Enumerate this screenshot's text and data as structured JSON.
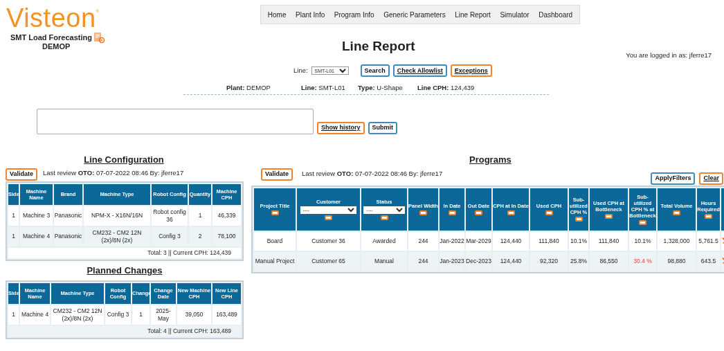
{
  "logo": {
    "name": "Visteon",
    "mark": "®",
    "app_name": "SMT Load Forecasting",
    "plant": "DEMOP"
  },
  "nav": [
    "Home",
    "Plant Info",
    "Program Info",
    "Generic Parameters",
    "Line Report",
    "Simulator",
    "Dashboard"
  ],
  "page_title": "Line Report",
  "user": {
    "label": "You are logged in as:",
    "name": "jferre17"
  },
  "line_picker": {
    "label": "Line:",
    "value": "SMT-L01"
  },
  "top_buttons": [
    {
      "label": "Search",
      "kind": "submit"
    },
    {
      "label": "Check Allowlist",
      "kind": "link"
    },
    {
      "label": "Exceptions",
      "kind": "reset"
    }
  ],
  "info": [
    {
      "label": "Plant:",
      "value": "DEMOP"
    },
    {
      "label": "Line:",
      "value": "SMT-L01"
    },
    {
      "label": "Type:",
      "value": "U-Shape"
    },
    {
      "label": "Line CPH:",
      "value": "124,439"
    }
  ],
  "comment_buttons": [
    {
      "label": "Show history",
      "kind": "reset"
    },
    {
      "label": "Submit",
      "kind": "submit"
    }
  ],
  "line_configuration": {
    "title": "Line Configuration",
    "validate": {
      "label": "Validate",
      "kind": "validate"
    },
    "review": {
      "prefix": "Last review ",
      "who": "OTO:",
      "rest": " 07-07-2022 08:46 By: jferre17"
    },
    "columns": [
      "Side",
      "Machine Name",
      "Brand",
      "Machine Type",
      "Robot Config",
      "Quantity",
      "Machine CPH"
    ],
    "rows": [
      [
        "1",
        "Machine 3",
        "Panasonic",
        "NPM-X - X16N/16N",
        "Robot config 36",
        "1",
        "46,339"
      ],
      [
        "1",
        "Machine 4",
        "Panasonic",
        "CM232 - CM2 12N (2x)/8N (2x)",
        "Config 3",
        "2",
        "78,100"
      ]
    ],
    "footer": "Total: 3 || Current CPH: 124,439"
  },
  "planned_changes": {
    "title": "Planned Changes",
    "columns": [
      "Side",
      "Machine Name",
      "Machine Type",
      "Robot Config",
      "Change",
      "Change Date",
      "New Machine CPH",
      "New Line CPH"
    ],
    "rows": [
      [
        "1",
        "Machine 4",
        "CM232 - CM2 12N (2x)/8N (2x)",
        "Config 3",
        "1",
        "2025-May",
        "39,050",
        "163,489"
      ]
    ],
    "footer": "Total: 4 || Current CPH: 163,489"
  },
  "programs": {
    "title": "Programs",
    "validate": {
      "label": "Validate",
      "kind": "validate"
    },
    "review": {
      "prefix": "Last review ",
      "who": "OTO:",
      "rest": " 07-07-2022 08:46 By: jferre17"
    },
    "filter_buttons": [
      {
        "label": "ApplyFilters",
        "kind": "submit"
      },
      {
        "label": "Clear",
        "kind": "reset"
      }
    ],
    "columns": [
      {
        "label": "Project Title",
        "kind": "filter"
      },
      {
        "label": "Customer",
        "kind": "select",
        "select": "----"
      },
      {
        "label": "Status",
        "kind": "select",
        "select": "----"
      },
      {
        "label": "Panel Width",
        "kind": "filter"
      },
      {
        "label": "In Date",
        "kind": "filter"
      },
      {
        "label": "Out Date",
        "kind": "filter"
      },
      {
        "label": "CPH at In Date",
        "kind": "filter"
      },
      {
        "label": "Used CPH",
        "kind": "filter"
      },
      {
        "label": "Sub-utilized CPH %",
        "kind": "filter"
      },
      {
        "label": "Used CPH at Bottleneck",
        "kind": "filter"
      },
      {
        "label": "Sub-utilized CPH % at Bottleneck",
        "kind": "filter"
      },
      {
        "label": "Total Volume",
        "kind": "filter"
      },
      {
        "label": "Hours Required",
        "kind": "filter"
      },
      {
        "kind": "plain"
      }
    ],
    "rows": [
      {
        "cells": [
          {
            "text": "Board",
            "warning": false
          },
          {
            "text": "Customer 36",
            "warning": false
          },
          {
            "text": "Awarded",
            "warning": false
          },
          {
            "text": "244",
            "warning": false
          },
          {
            "text": "Jan-2022",
            "warning": false
          },
          {
            "text": "Mar-2029",
            "warning": false
          },
          {
            "text": "124,440",
            "warning": false
          },
          {
            "text": "111,840",
            "warning": false
          },
          {
            "text": "10.1%",
            "warning": false
          },
          {
            "text": "111,840",
            "warning": false
          },
          {
            "text": "10.1%",
            "warning": false
          },
          {
            "text": "1,328,000",
            "warning": false
          },
          {
            "text": "5,761.5",
            "warning": false
          }
        ]
      },
      {
        "cells": [
          {
            "text": "Manual Project",
            "warning": false
          },
          {
            "text": "Customer 65",
            "warning": false
          },
          {
            "text": "Manual",
            "warning": false
          },
          {
            "text": "244",
            "warning": false
          },
          {
            "text": "Jan-2023",
            "warning": false
          },
          {
            "text": "Dec-2023",
            "warning": false
          },
          {
            "text": "124,440",
            "warning": false
          },
          {
            "text": "92,320",
            "warning": false
          },
          {
            "text": "25.8%",
            "warning": false
          },
          {
            "text": "86,550",
            "warning": false
          },
          {
            "text": "30.4 %",
            "warning": true
          },
          {
            "text": "98,880",
            "warning": false
          },
          {
            "text": "643.5",
            "warning": false
          }
        ]
      }
    ]
  }
}
